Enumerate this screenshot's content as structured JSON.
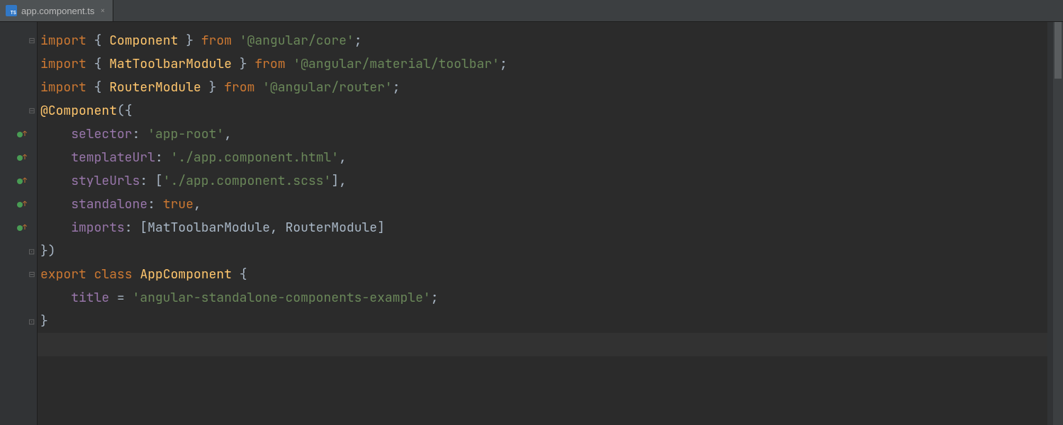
{
  "tab": {
    "filename": "app.component.ts"
  },
  "code": {
    "lines": [
      {
        "type": "import",
        "kw": "import",
        "b1": " { ",
        "sym": "Component",
        "b2": " } ",
        "from": "from",
        "sp": " ",
        "str": "'@angular/core'",
        "end": ";"
      },
      {
        "type": "import",
        "kw": "import",
        "b1": " { ",
        "sym": "MatToolbarModule",
        "b2": " } ",
        "from": "from",
        "sp": " ",
        "str": "'@angular/material/toolbar'",
        "end": ";"
      },
      {
        "type": "import",
        "kw": "import",
        "b1": " { ",
        "sym": "RouterModule",
        "b2": " } ",
        "from": "from",
        "sp": " ",
        "str": "'@angular/router'",
        "end": ";"
      },
      {
        "type": "decostart",
        "at": "@",
        "deco": "Component",
        "open": "({"
      },
      {
        "type": "prop",
        "indent": "    ",
        "key": "selector",
        "colon": ": ",
        "val": "'app-root'",
        "comma": ","
      },
      {
        "type": "prop",
        "indent": "    ",
        "key": "templateUrl",
        "colon": ": ",
        "val": "'./app.component.html'",
        "comma": ","
      },
      {
        "type": "proparr",
        "indent": "    ",
        "key": "styleUrls",
        "colon": ": [",
        "val": "'./app.component.scss'",
        "close": "],"
      },
      {
        "type": "propkw",
        "indent": "    ",
        "key": "standalone",
        "colon": ": ",
        "val": "true",
        "comma": ","
      },
      {
        "type": "propplain",
        "indent": "    ",
        "key": "imports",
        "colon": ": [",
        "val": "MatToolbarModule, RouterModule",
        "close": "]"
      },
      {
        "type": "decoend",
        "text": "})"
      },
      {
        "type": "classdecl",
        "kw1": "export",
        "sp1": " ",
        "kw2": "class",
        "sp2": " ",
        "name": "AppComponent",
        "sp3": " ",
        "brace": "{"
      },
      {
        "type": "assign",
        "indent": "    ",
        "key": "title",
        "eq": " = ",
        "val": "'angular-standalone-components-example'",
        "end": ";"
      },
      {
        "type": "closebrace",
        "text": "}"
      }
    ]
  },
  "gutter": {
    "indicators": [
      "",
      "",
      "",
      "",
      "green-up",
      "green-up",
      "green-up",
      "green-up",
      "green-up",
      "",
      "",
      "",
      ""
    ]
  },
  "fold": {
    "marks": [
      "minus",
      "",
      "",
      "minus",
      "",
      "",
      "",
      "",
      "",
      "end",
      "minus",
      "",
      "end"
    ]
  },
  "caretLine": 13
}
